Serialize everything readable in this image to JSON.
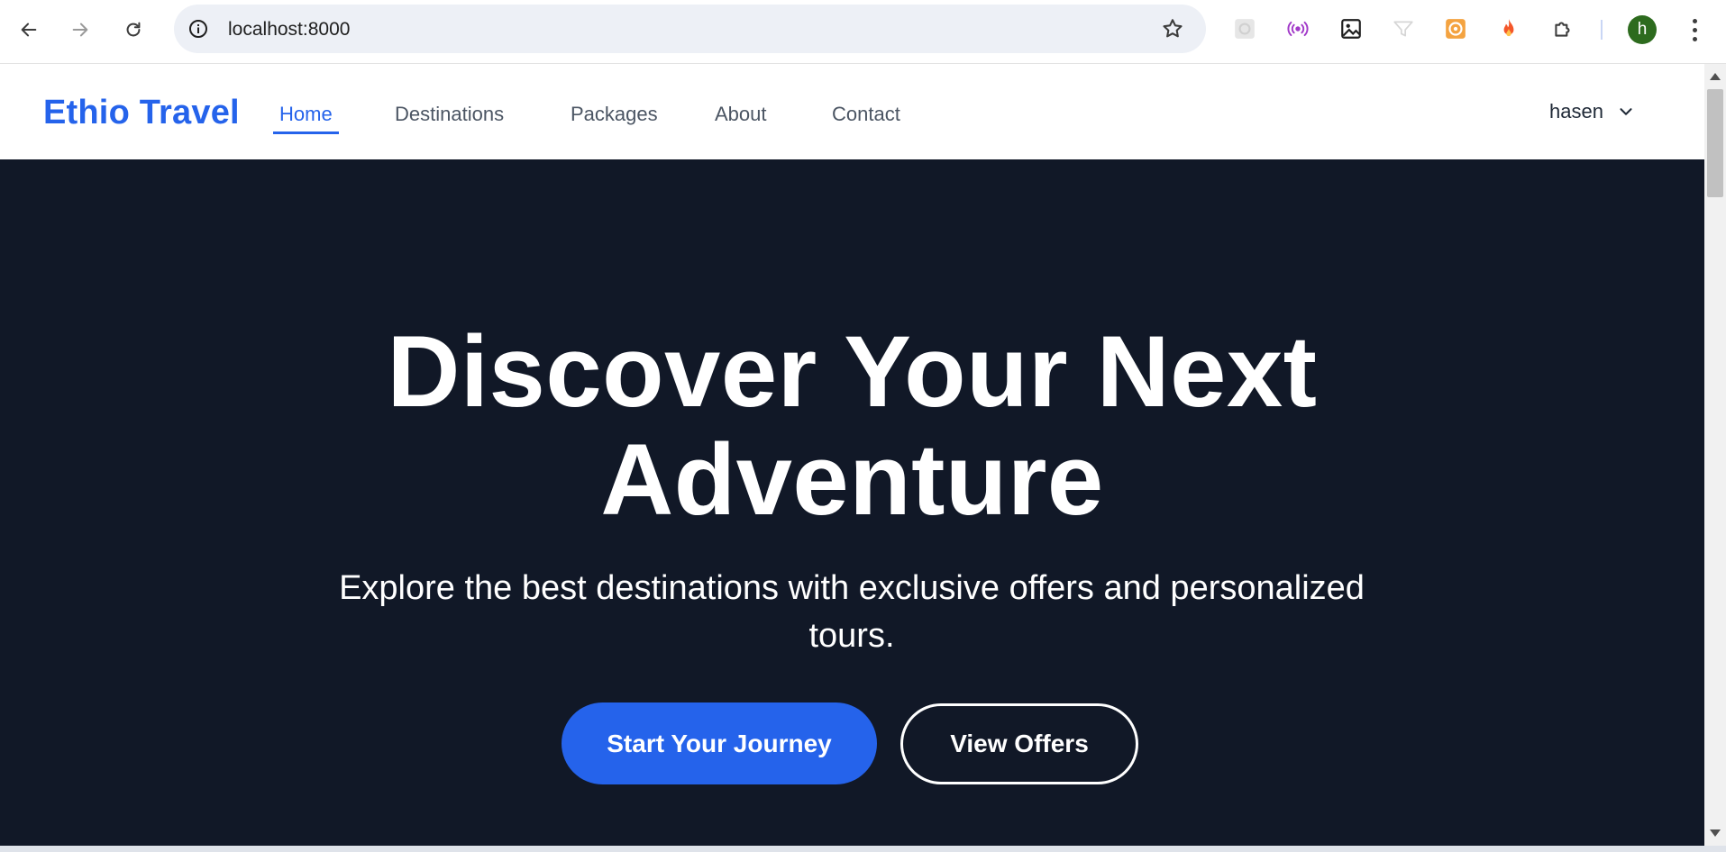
{
  "browser": {
    "url": "localhost:8000",
    "profile_initial": "h",
    "icons": {
      "back": "arrow-left-icon",
      "forward": "arrow-right-icon",
      "reload": "reload-icon",
      "site_info": "info-icon",
      "bookmark": "star-icon",
      "menu": "more-vert-icon"
    },
    "extensions": [
      "extension-grey-icon",
      "broadcast-icon",
      "image-icon",
      "filter-icon",
      "orange-target-icon",
      "fire-icon",
      "puzzle-icon"
    ]
  },
  "site": {
    "brand": "Ethio Travel",
    "nav": {
      "items": [
        {
          "label": "Home",
          "active": true
        },
        {
          "label": "Destinations",
          "active": false
        },
        {
          "label": "Packages",
          "active": false
        },
        {
          "label": "About",
          "active": false
        },
        {
          "label": "Contact",
          "active": false
        }
      ]
    },
    "user": {
      "name": "hasen"
    }
  },
  "hero": {
    "title_line1": "Discover Your Next",
    "title_line2": "Adventure",
    "subtitle_line1": "Explore the best destinations with exclusive offers and personalized",
    "subtitle_line2": "tours.",
    "primary_button": "Start Your Journey",
    "secondary_button": "View Offers"
  },
  "colors": {
    "brand": "#2563eb",
    "hero_bg": "#111827",
    "nav_text": "#4b5563"
  }
}
